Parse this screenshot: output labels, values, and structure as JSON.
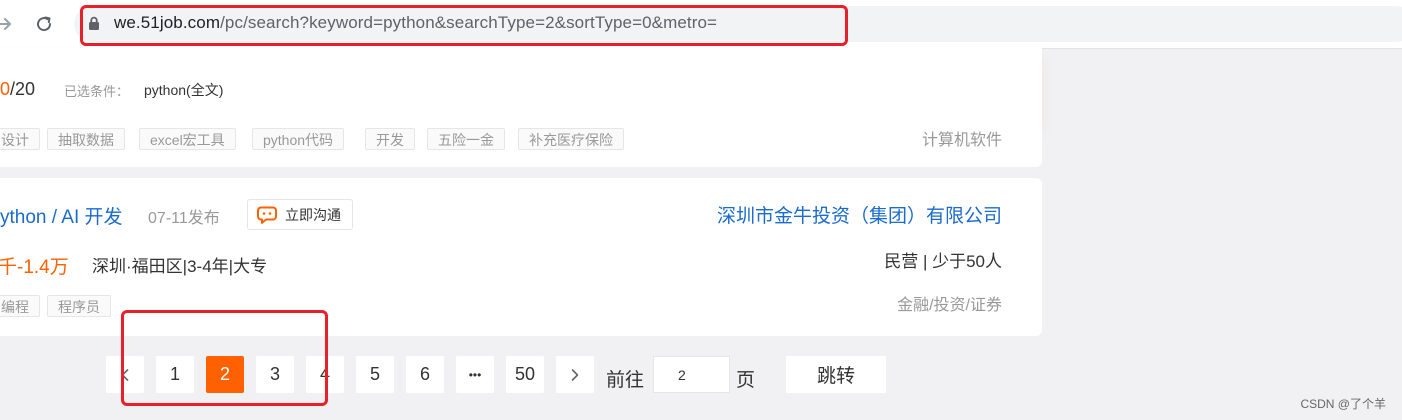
{
  "browser": {
    "url_host": "we.51job.com",
    "url_path": "/pc/search?keyword=python&searchType=2&sortType=0&metro="
  },
  "filters": {
    "page_current": "0",
    "page_total": "/20",
    "selected_label": "已选条件：",
    "selected_value": "python(全文)"
  },
  "job1": {
    "tags": [
      "设计",
      "抽取数据",
      "excel宏工具",
      "python代码",
      "开发",
      "五险一金",
      "补充医疗保险"
    ],
    "industry": "计算机软件"
  },
  "job2": {
    "title": "ython / AI 开发",
    "date": "07-11发布",
    "chat_label": "立即沟通",
    "company": "深圳市金牛投资（集团）有限公司",
    "salary": "千-1.4万",
    "meta": "深圳·福田区|3-4年|大专",
    "company_type": "民营 | 少于50人",
    "tags": [
      "编程",
      "程序员"
    ],
    "industry": "金融/投资/证券"
  },
  "pagination": {
    "pages": [
      "1",
      "2",
      "3",
      "4",
      "5",
      "6",
      "•••",
      "50"
    ],
    "active": "2",
    "goto_prefix": "前往",
    "goto_value": "2",
    "goto_suffix": "页",
    "jump_label": "跳转"
  },
  "watermark": "CSDN @了个羊",
  "colors": {
    "accent": "#ff6000",
    "link": "#1a6bcd",
    "annotation": "#e8202a"
  }
}
